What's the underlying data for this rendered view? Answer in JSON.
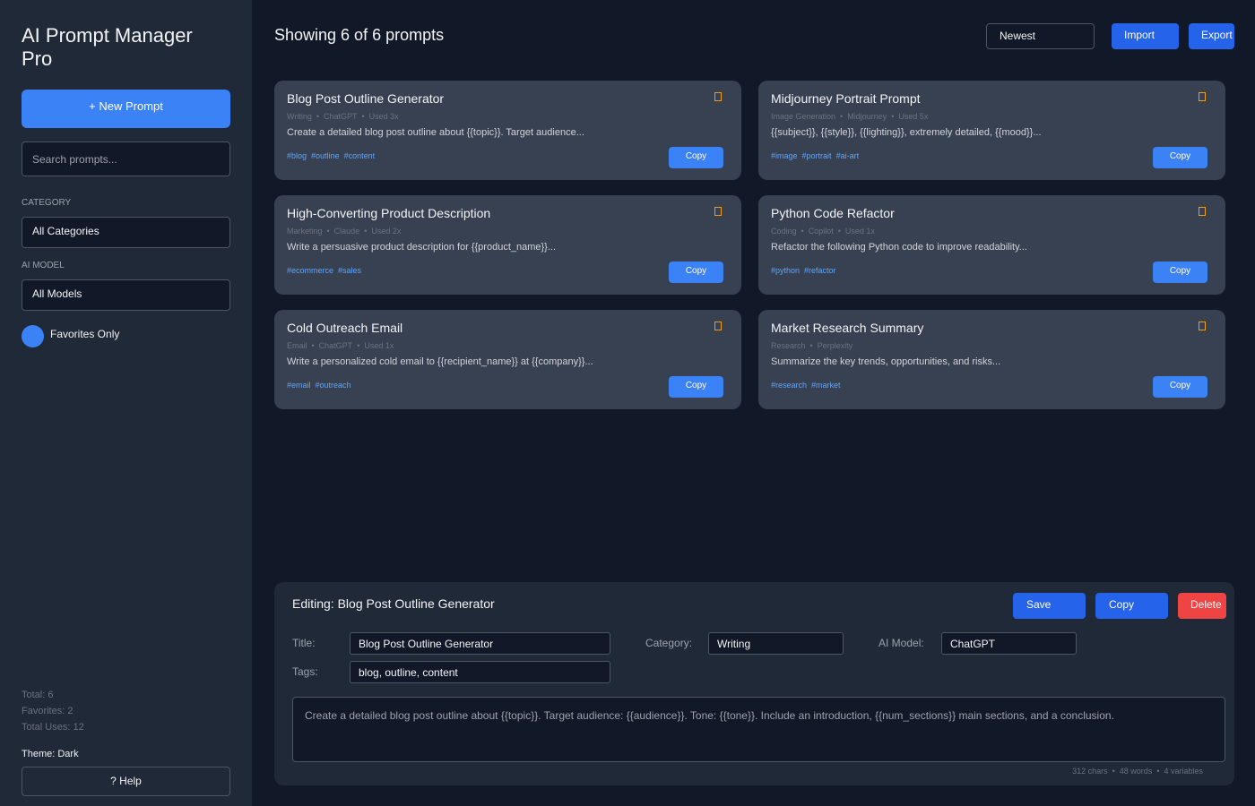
{
  "sidebar": {
    "app_title": "AI Prompt Manager Pro",
    "new_prompt_label": "+ New Prompt",
    "search_placeholder": "Search prompts...",
    "category_label": "CATEGORY",
    "category_value": "All Categories",
    "model_label": "AI MODEL",
    "model_value": "All Models",
    "favorites_label": "Favorites Only",
    "stats": {
      "total": "Total: 6",
      "favorites": "Favorites: 2",
      "total_uses": "Total Uses: 12"
    },
    "theme_label": "Theme: Dark",
    "help_label": "? Help"
  },
  "header": {
    "showing": "Showing 6 of 6 prompts",
    "sort_value": "Newest",
    "import_label": "Import",
    "export_label": "Export"
  },
  "cards": [
    {
      "title": "Blog Post Outline Generator",
      "category": "Writing",
      "model": "ChatGPT",
      "used": "Used 3x",
      "description": "Create a detailed blog post outline about {{topic}}. Target audience...",
      "tags": [
        "#blog",
        "#outline",
        "#content"
      ],
      "copy_label": "Copy"
    },
    {
      "title": "Midjourney Portrait Prompt",
      "category": "Image Generation",
      "model": "Midjourney",
      "used": "Used 5x",
      "description": "{{subject}}, {{style}}, {{lighting}}, extremely detailed, {{mood}}...",
      "tags": [
        "#image",
        "#portrait",
        "#ai-art"
      ],
      "copy_label": "Copy"
    },
    {
      "title": "High-Converting Product Description",
      "category": "Marketing",
      "model": "Claude",
      "used": "Used 2x",
      "description": "Write a persuasive product description for {{product_name}}...",
      "tags": [
        "#ecommerce",
        "#sales"
      ],
      "copy_label": "Copy"
    },
    {
      "title": "Python Code Refactor",
      "category": "Coding",
      "model": "Copilot",
      "used": "Used 1x",
      "description": "Refactor the following Python code to improve readability...",
      "tags": [
        "#python",
        "#refactor"
      ],
      "copy_label": "Copy"
    },
    {
      "title": "Cold Outreach Email",
      "category": "Email",
      "model": "ChatGPT",
      "used": "Used 1x",
      "description": "Write a personalized cold email to {{recipient_name}} at {{company}}...",
      "tags": [
        "#email",
        "#outreach"
      ],
      "copy_label": "Copy"
    },
    {
      "title": "Market Research Summary",
      "category": "Research",
      "model": "Perplexity",
      "used": "",
      "description": "Summarize the key trends, opportunities, and risks...",
      "tags": [
        "#research",
        "#market"
      ],
      "copy_label": "Copy"
    }
  ],
  "editor": {
    "heading": "Editing: Blog Post Outline Generator",
    "save_label": "Save",
    "copy_label": "Copy",
    "delete_label": "Delete",
    "title_label": "Title:",
    "title_value": "Blog Post Outline Generator",
    "category_label": "Category:",
    "category_value": "Writing",
    "model_label": "AI Model:",
    "model_value": "ChatGPT",
    "tags_label": "Tags:",
    "tags_value": "blog, outline, content",
    "prompt_text": "Create a detailed blog post outline about {{topic}}. Target audience: {{audience}}. Tone: {{tone}}. Include an introduction, {{num_sections}} main sections, and a conclusion.",
    "counts": {
      "chars": "312 chars",
      "words": "48 words",
      "variables": "4 variables"
    }
  },
  "colors": {
    "accent": "#3b82f6",
    "accent_dark": "#2563eb",
    "danger": "#ef4444",
    "star": "#f59e0b",
    "tag": "#60a5fa"
  }
}
